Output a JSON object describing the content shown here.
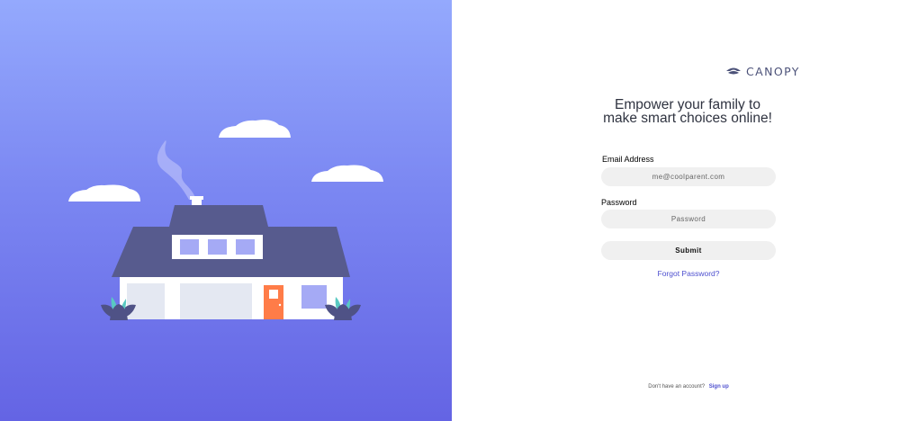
{
  "brand": {
    "name": "CANOPY",
    "color": "#4c5279"
  },
  "hero": {
    "illustration": "house-illustration",
    "gradient_top": "#94a9fd",
    "gradient_bottom": "#6464e4"
  },
  "login": {
    "headline_line1": "Empower your family to",
    "headline_line2": "make smart choices online!",
    "email_label": "Email Address",
    "email_placeholder": "me@coolparent.com",
    "email_value": "",
    "password_label": "Password",
    "password_placeholder": "Password",
    "password_value": "",
    "submit_label": "Submit",
    "forgot_label": "Forgot Password?",
    "accent_color": "#4d4fcf"
  },
  "footer": {
    "no_account_text": "Don't have an account?",
    "signup_label": "Sign up"
  }
}
